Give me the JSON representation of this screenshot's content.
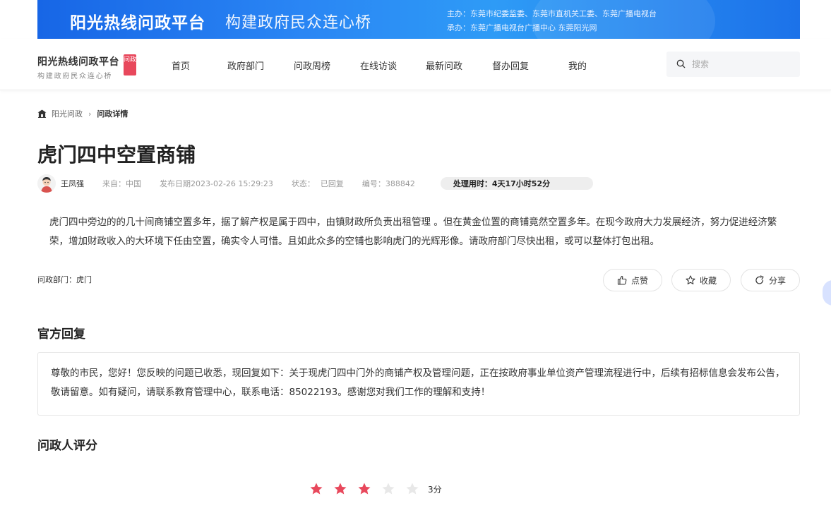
{
  "banner": {
    "title": "阳光热线问政平台",
    "slogan": "构建政府民众连心桥",
    "host_line1": "主办：东莞市纪委监委、东莞市直机关工委、东莞广播电视台",
    "host_line2": "承办：东莞广播电视台广播中心 东莞阳光网"
  },
  "logo": {
    "main": "阳光热线问政平台",
    "sub": "构建政府民众连心桥",
    "badge": "问政"
  },
  "nav": {
    "items": [
      "首页",
      "政府部门",
      "问政周榜",
      "在线访谈",
      "最新问政",
      "督办回复",
      "我的"
    ]
  },
  "search": {
    "placeholder": "搜索"
  },
  "breadcrumb": {
    "home": "阳光问政",
    "current": "问政详情"
  },
  "question": {
    "title": "虎门四中空置商铺",
    "author": "王凤强",
    "source_label": "来自：",
    "source_value": "中国",
    "date_label": "发布日期",
    "date_value": "2023-02-26 15:29:23",
    "status_label": "状态：",
    "status_value": "已回复",
    "number_label": "编号：",
    "number_value": "388842",
    "duration": "处理用时：4天17小时52分",
    "content": "虎门四中旁边的的几十间商铺空置多年，据了解产权是属于四中，由镇财政所负责出租管理 。但在黄金位置的商铺竟然空置多年。在现今政府大力发展经济，努力促进经济繁荣，增加财政收入的大环境下任由空置，确实令人可惜。且如此众多的空铺也影响虎门的光辉形像。请政府部门尽快出租，或可以整体打包出租。",
    "department": "问政部门：虎门"
  },
  "actions": {
    "like": "点赞",
    "favorite": "收藏",
    "share": "分享"
  },
  "reply": {
    "section_title": "官方回复",
    "content": "尊敬的市民，您好！您反映的问题已收悉，现回复如下：关于现虎门四中门外的商铺产权及管理问题，正在按政府事业单位资产管理流程进行中，后续有招标信息会发布公告，敬请留意。如有疑问，请联系教育管理中心，联系电话：85022193。感谢您对我们工作的理解和支持！"
  },
  "rating": {
    "section_title": "问政人评分",
    "score": 3,
    "max": 5,
    "label": "3分",
    "filled_color": "#e8485c",
    "empty_color": "#e8e8e8"
  }
}
